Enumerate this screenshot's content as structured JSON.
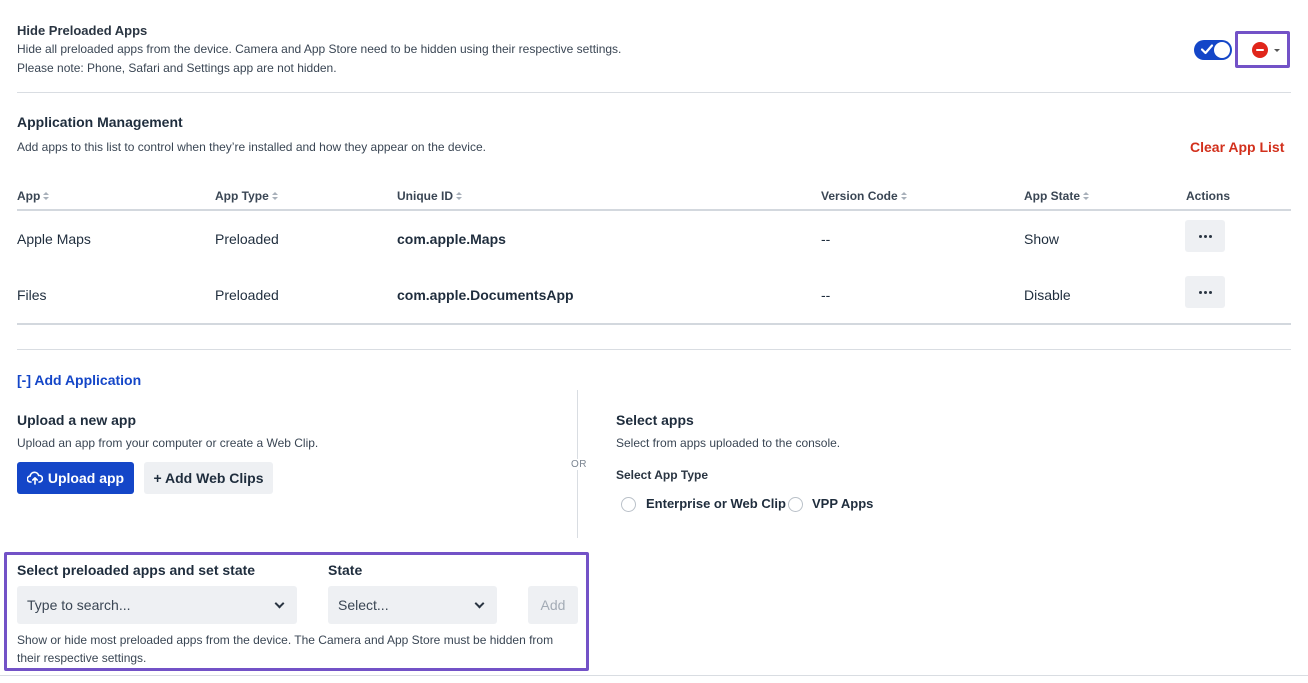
{
  "hide_preloaded": {
    "title": "Hide Preloaded Apps",
    "desc_line1": "Hide all preloaded apps from the device. Camera and App Store need to be hidden using their respective settings.",
    "desc_line2": "Please note: Phone, Safari and Settings app are not hidden.",
    "toggle_on": true
  },
  "app_management": {
    "title": "Application Management",
    "desc": "Add apps to this list to control when they’re installed and how they appear on the device.",
    "clear_label": "Clear App List"
  },
  "table": {
    "headers": [
      "App",
      "App Type",
      "Unique ID",
      "Version Code",
      "App State",
      "Actions"
    ],
    "rows": [
      {
        "app": "Apple Maps",
        "type": "Preloaded",
        "id": "com.apple.Maps",
        "version": "--",
        "state": "Show"
      },
      {
        "app": "Files",
        "type": "Preloaded",
        "id": "com.apple.DocumentsApp",
        "version": "--",
        "state": "Disable"
      }
    ]
  },
  "add_application": {
    "toggle_label": "[-] Add Application",
    "upload": {
      "title": "Upload a new app",
      "desc": "Upload an app from your computer or create a Web Clip.",
      "upload_label": "Upload app",
      "webclip_label": "+ Add Web Clips"
    },
    "or_label": "OR",
    "select": {
      "title": "Select apps",
      "desc": "Select from apps uploaded to the console.",
      "type_label": "Select App Type",
      "options": [
        "Enterprise or Web Clip",
        "VPP Apps"
      ]
    }
  },
  "preloaded_state": {
    "apps_label": "Select preloaded apps and set state",
    "apps_placeholder": "Type to search...",
    "state_label": "State",
    "state_placeholder": "Select...",
    "add_label": "Add",
    "help_line1": "Show or hide most preloaded apps from the device. The Camera and App Store must be hidden from",
    "help_line2": "their respective settings."
  },
  "colors": {
    "accent": "#1446c8",
    "danger": "#e0261b",
    "highlight": "#7352c7"
  }
}
